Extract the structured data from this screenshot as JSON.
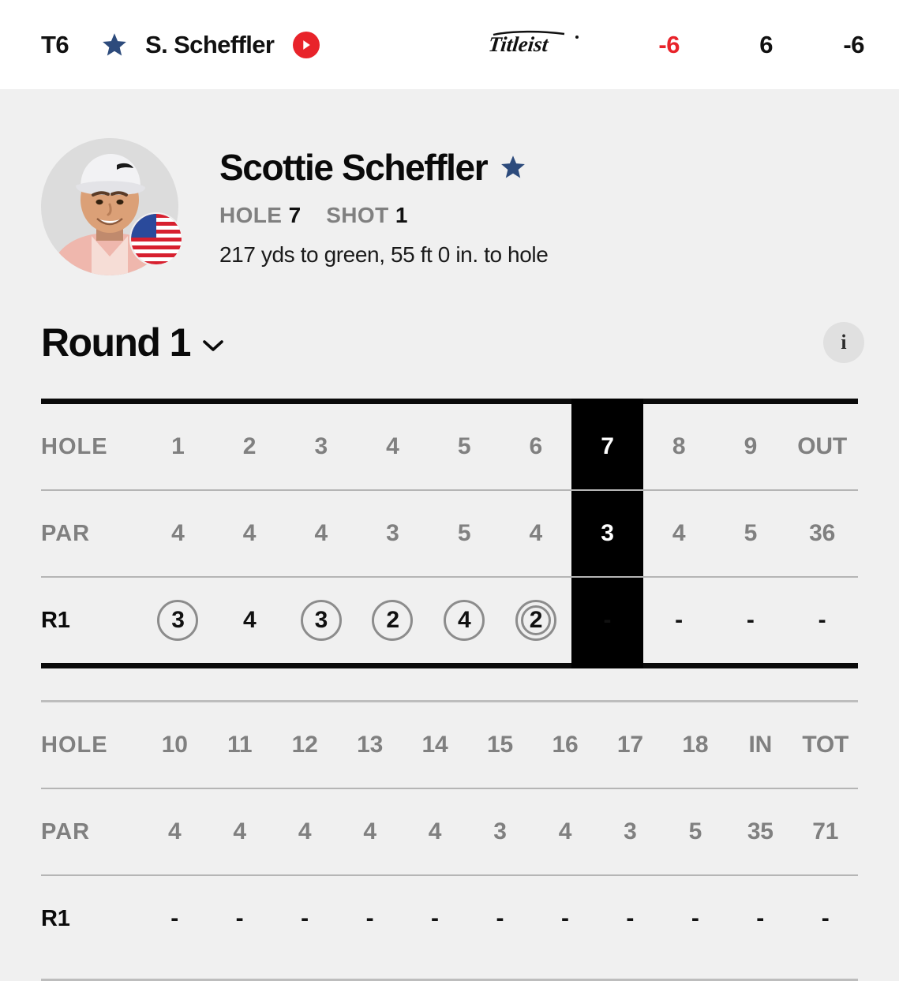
{
  "leaderboard_row": {
    "position": "T6",
    "star_icon": "star-icon",
    "player_short_name": "S. Scheffler",
    "play_icon": "play-circle-icon",
    "brand": "Titleist",
    "score_to_par": "-6",
    "thru": "6",
    "round_score": "-6",
    "score_color": "#e8232a",
    "play_button_color": "#e8232a",
    "star_color": "#2d4b7c"
  },
  "player": {
    "full_name": "Scottie Scheffler",
    "favorite_star_icon": "star-icon",
    "country_flag": "us-flag-icon",
    "avatar": "player-headshot",
    "hole_label": "HOLE",
    "hole_value": "7",
    "shot_label": "SHOT",
    "shot_value": "1",
    "shot_detail": "217 yds to green, 55 ft 0 in. to hole"
  },
  "round_header": {
    "title": "Round 1",
    "chevron_icon": "chevron-down-icon",
    "info_icon": "info-icon",
    "info_label": "i"
  },
  "scorecard": {
    "front": {
      "hole_label": "HOLE",
      "par_label": "PAR",
      "round_label": "R1",
      "holes": [
        "1",
        "2",
        "3",
        "4",
        "5",
        "6",
        "7",
        "8",
        "9",
        "OUT"
      ],
      "par": [
        "4",
        "4",
        "4",
        "3",
        "5",
        "4",
        "3",
        "4",
        "5",
        "36"
      ],
      "scores": [
        "3",
        "4",
        "3",
        "2",
        "4",
        "2",
        "-",
        "-",
        "-",
        "-"
      ],
      "score_marks": [
        "birdie",
        "par",
        "birdie",
        "birdie",
        "birdie",
        "eagle",
        "none",
        "none",
        "none",
        "none"
      ],
      "active_index": 6
    },
    "back": {
      "hole_label": "HOLE",
      "par_label": "PAR",
      "round_label": "R1",
      "holes": [
        "10",
        "11",
        "12",
        "13",
        "14",
        "15",
        "16",
        "17",
        "18",
        "IN",
        "TOT"
      ],
      "par": [
        "4",
        "4",
        "4",
        "4",
        "4",
        "3",
        "4",
        "3",
        "5",
        "35",
        "71"
      ],
      "scores": [
        "-",
        "-",
        "-",
        "-",
        "-",
        "-",
        "-",
        "-",
        "-",
        "-",
        "-"
      ],
      "score_marks": [
        "none",
        "none",
        "none",
        "none",
        "none",
        "none",
        "none",
        "none",
        "none",
        "none",
        "none"
      ],
      "active_index": -1
    }
  }
}
